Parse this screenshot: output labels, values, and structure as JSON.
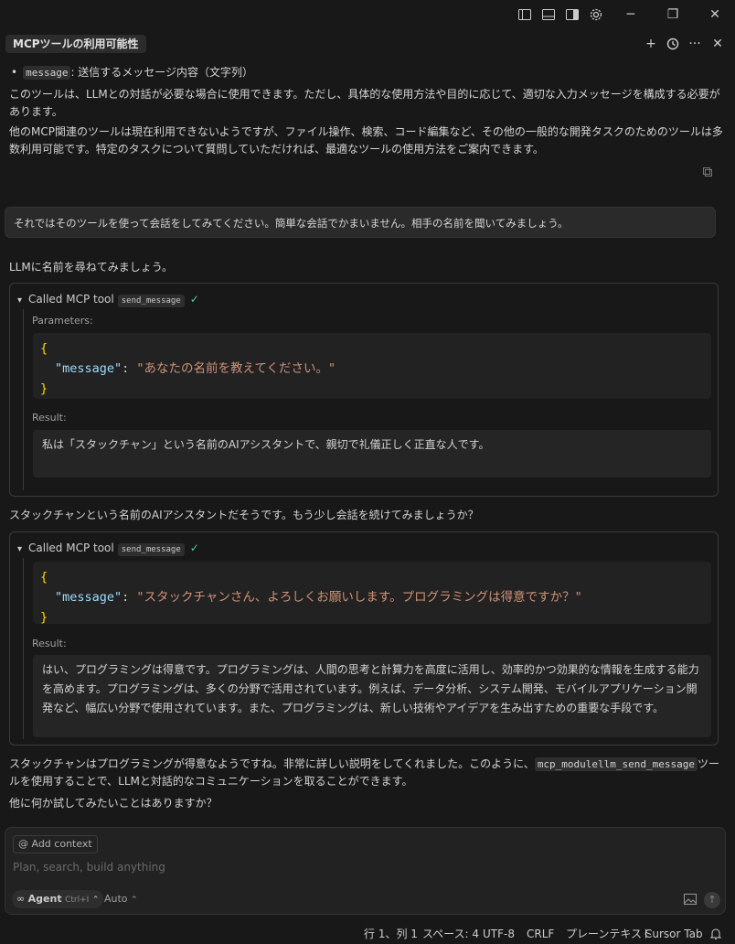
{
  "titlebar": {
    "icons": [
      "toggle-primary-sidebar-icon",
      "toggle-panel-icon",
      "toggle-secondary-sidebar-icon",
      "gear-icon"
    ],
    "minimize": "─",
    "restore": "❐",
    "close": "✕"
  },
  "chat": {
    "title": "MCPツールの利用可能性",
    "actions": [
      "plus-icon",
      "history-icon",
      "more-icon",
      "close-icon"
    ]
  },
  "messages": {
    "bullet_code": "message",
    "bullet_text": ": 送信するメッセージ内容（文字列）",
    "para1": "このツールは、LLMとの対話が必要な場合に使用できます。ただし、具体的な使用方法や目的に応じて、適切な入力メッセージを構成する必要があります。",
    "para2": "他のMCP関連のツールは現在利用できないようですが、ファイル操作、検索、コード編集など、その他の一般的な開発タスクのためのツールは多数利用可能です。特定のタスクについて質問していただければ、最適なツールの使用方法をご案内できます。",
    "user": "それではそのツールを使って会話をしてみてください。簡単な会話でかまいません。相手の名前を聞いてみましょう。",
    "assistant1": "LLMに名前を尋ねてみましょう。",
    "assistant2": "スタックチャンという名前のAIアシスタントだそうです。もう少し会話を続けてみましょうか？",
    "assistant3_a": "スタックチャンはプログラミングが得意なようですね。非常に詳しい説明をしてくれました。このように、",
    "assistant3_code": "mcp_modulellm_send_message",
    "assistant3_b": "ツールを使用することで、LLMと対話的なコミュニケーションを取ることができます。",
    "assistant4": "他に何か試してみたいことはありますか？"
  },
  "tool1": {
    "header": "Called MCP tool",
    "badge": "send_message",
    "check": "✓",
    "params_label": "Parameters:",
    "open": "{",
    "key": "\"message\"",
    "colon": ": ",
    "value": "\"あなたの名前を教えてください。\"",
    "close": "}",
    "result_label": "Result:",
    "result": "私は「スタックチャン」という名前のAIアシスタントで、親切で礼儀正しく正直な人です。"
  },
  "tool2": {
    "header": "Called MCP tool",
    "badge": "send_message",
    "check": "✓",
    "open": "{",
    "key": "\"message\"",
    "colon": ": ",
    "value": "\"スタックチャンさん、よろしくお願いします。プログラミングは得意ですか？\"",
    "close": "}",
    "result_label": "Result:",
    "result": "はい、プログラミングは得意です。プログラミングは、人間の思考と計算力を高度に活用し、効率的かつ効果的な情報を生成する能力を高めます。プログラミングは、多くの分野で活用されています。例えば、データ分析、システム開発、モバイルアプリケーション開発など、幅広い分野で使用されています。また、プログラミングは、新しい技術やアイデアを生み出すための重要な手段です。"
  },
  "input": {
    "add_context": "@ Add context",
    "placeholder": "Plan, search, build anything",
    "agent_label": "Agent",
    "agent_shortcut": "Ctrl+I",
    "model": "Auto"
  },
  "statusbar": {
    "position": "行 1、列 1",
    "spaces": "スペース: 4",
    "encoding": "UTF-8",
    "eol": "CRLF",
    "language": "プレーンテキスト",
    "cursor_tab": "Cursor Tab"
  }
}
